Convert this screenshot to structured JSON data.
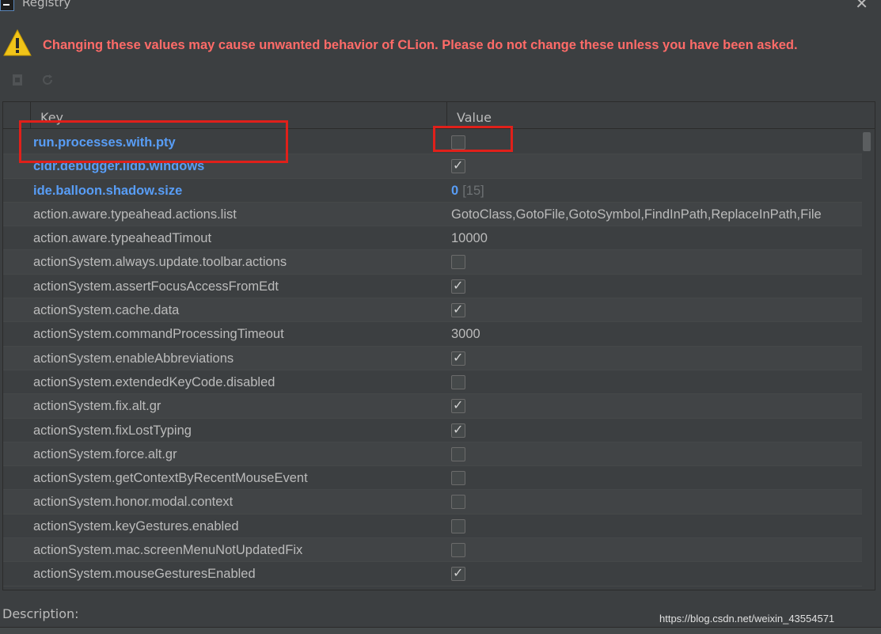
{
  "window": {
    "title": "Registry",
    "close_glyph": "✕"
  },
  "warning": {
    "icon": "warning-icon",
    "text": "Changing these values may cause unwanted behavior of CLion. Please do not change these unless you have been asked."
  },
  "toolbar": {
    "icons": [
      "restore-defaults-icon",
      "refresh-icon"
    ]
  },
  "table": {
    "headers": {
      "key": "Key",
      "value": "Value"
    },
    "rows": [
      {
        "key": "run.processes.with.pty",
        "modified": true,
        "type": "checkbox",
        "checked": false
      },
      {
        "key": "cidr.debugger.lldb.windows",
        "modified": true,
        "type": "checkbox",
        "checked": true
      },
      {
        "key": "ide.balloon.shadow.size",
        "modified": true,
        "type": "text",
        "value": "0",
        "default": "[15]"
      },
      {
        "key": "action.aware.typeahead.actions.list",
        "modified": false,
        "type": "text",
        "value": "GotoClass,GotoFile,GotoSymbol,FindInPath,ReplaceInPath,File"
      },
      {
        "key": "action.aware.typeaheadTimout",
        "modified": false,
        "type": "text",
        "value": "10000"
      },
      {
        "key": "actionSystem.always.update.toolbar.actions",
        "modified": false,
        "type": "checkbox",
        "checked": false
      },
      {
        "key": "actionSystem.assertFocusAccessFromEdt",
        "modified": false,
        "type": "checkbox",
        "checked": true
      },
      {
        "key": "actionSystem.cache.data",
        "modified": false,
        "type": "checkbox",
        "checked": true
      },
      {
        "key": "actionSystem.commandProcessingTimeout",
        "modified": false,
        "type": "text",
        "value": "3000"
      },
      {
        "key": "actionSystem.enableAbbreviations",
        "modified": false,
        "type": "checkbox",
        "checked": true
      },
      {
        "key": "actionSystem.extendedKeyCode.disabled",
        "modified": false,
        "type": "checkbox",
        "checked": false
      },
      {
        "key": "actionSystem.fix.alt.gr",
        "modified": false,
        "type": "checkbox",
        "checked": true
      },
      {
        "key": "actionSystem.fixLostTyping",
        "modified": false,
        "type": "checkbox",
        "checked": true
      },
      {
        "key": "actionSystem.force.alt.gr",
        "modified": false,
        "type": "checkbox",
        "checked": false
      },
      {
        "key": "actionSystem.getContextByRecentMouseEvent",
        "modified": false,
        "type": "checkbox",
        "checked": false
      },
      {
        "key": "actionSystem.honor.modal.context",
        "modified": false,
        "type": "checkbox",
        "checked": false
      },
      {
        "key": "actionSystem.keyGestures.enabled",
        "modified": false,
        "type": "checkbox",
        "checked": false
      },
      {
        "key": "actionSystem.mac.screenMenuNotUpdatedFix",
        "modified": false,
        "type": "checkbox",
        "checked": false
      },
      {
        "key": "actionSystem.mouseGesturesEnabled",
        "modified": false,
        "type": "checkbox",
        "checked": true
      }
    ]
  },
  "description": {
    "label": "Description:"
  },
  "watermark": "https://blog.csdn.net/weixin_43554571",
  "colors": {
    "background": "#3c3f41",
    "warning_text": "#ff6b68",
    "modified_key": "#589df6",
    "highlight_box": "#e0201a"
  }
}
